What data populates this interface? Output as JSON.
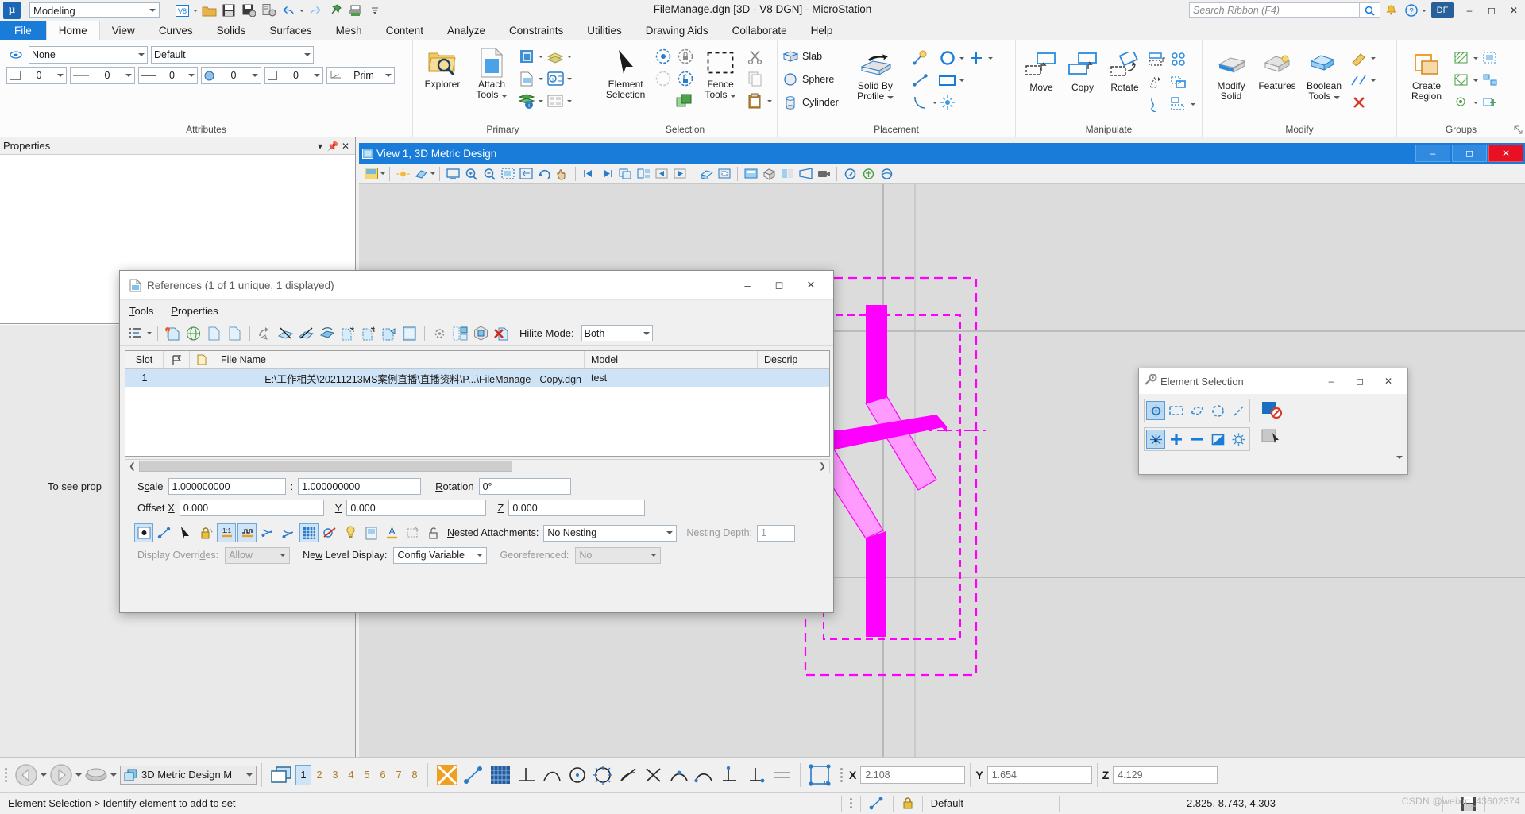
{
  "titlebar": {
    "app_title": "FileManage.dgn [3D - V8 DGN] - MicroStation",
    "workspace": "Modeling",
    "search_placeholder": "Search Ribbon (F4)",
    "user_initials": "DF",
    "logo_text": "μ",
    "quick_access": [
      {
        "name": "v8-format-icon",
        "label": "V8"
      },
      {
        "name": "open-file-icon",
        "label": "Open"
      },
      {
        "name": "save-icon",
        "label": "Save"
      },
      {
        "name": "save-settings-icon",
        "label": "Save Settings"
      },
      {
        "name": "save-as-icon",
        "label": "Save As"
      },
      {
        "name": "undo-icon",
        "label": "Undo"
      },
      {
        "name": "redo-icon",
        "label": "Redo"
      },
      {
        "name": "pin-icon",
        "label": "Pin"
      },
      {
        "name": "print-icon",
        "label": "Print"
      },
      {
        "name": "customize-icon",
        "label": "Customize Quick Access Toolbar"
      }
    ],
    "window_buttons": [
      "minimize",
      "maximize",
      "close"
    ]
  },
  "ribbon": {
    "tabs": [
      {
        "label": "File",
        "state": "file"
      },
      {
        "label": "Home",
        "state": "active"
      },
      {
        "label": "View",
        "state": "normal"
      },
      {
        "label": "Curves",
        "state": "normal"
      },
      {
        "label": "Solids",
        "state": "normal"
      },
      {
        "label": "Surfaces",
        "state": "normal"
      },
      {
        "label": "Mesh",
        "state": "normal"
      },
      {
        "label": "Content",
        "state": "normal"
      },
      {
        "label": "Analyze",
        "state": "normal"
      },
      {
        "label": "Constraints",
        "state": "normal"
      },
      {
        "label": "Utilities",
        "state": "normal"
      },
      {
        "label": "Drawing Aids",
        "state": "normal"
      },
      {
        "label": "Collaborate",
        "state": "normal"
      },
      {
        "label": "Help",
        "state": "normal"
      }
    ],
    "groups": [
      {
        "name": "attributes",
        "label": "Attributes",
        "level_value": "None",
        "style_value": "Default",
        "color_value": "0",
        "weight_value": "0",
        "linestyle_value": "0",
        "transparency_value": "0",
        "priority_value": "0",
        "prim_label": "Prim"
      },
      {
        "name": "primary",
        "label": "Primary",
        "buttons": [
          "Explorer",
          "Attach Tools"
        ]
      },
      {
        "name": "selection",
        "label": "Selection",
        "buttons": [
          "Element Selection",
          "Fence Tools"
        ]
      },
      {
        "name": "placement",
        "label": "Placement",
        "buttons": [
          "Slab",
          "Sphere",
          "Cylinder",
          "Solid By Profile"
        ]
      },
      {
        "name": "manipulate",
        "label": "Manipulate",
        "buttons": [
          "Move",
          "Copy",
          "Rotate"
        ]
      },
      {
        "name": "modify",
        "label": "Modify",
        "buttons": [
          "Modify Solid",
          "Features",
          "Boolean Tools"
        ]
      },
      {
        "name": "groups",
        "label": "Groups",
        "buttons": [
          "Create Region"
        ]
      }
    ]
  },
  "properties_panel": {
    "title": "Properties",
    "message": "To see prop",
    "header_buttons": [
      "dropdown",
      "pin",
      "close"
    ]
  },
  "view_window": {
    "title": "View 1, 3D Metric Design",
    "window_buttons": [
      "minimize",
      "restore",
      "close"
    ],
    "toolbar_icons": [
      "view-attributes-icon",
      "adjust-brightness-icon",
      "display-style-icon",
      "update-view-icon",
      "zoom-in-icon",
      "zoom-out-icon",
      "window-area-icon",
      "fit-view-icon",
      "rotate-view-icon",
      "pan-view-icon",
      "view-previous-icon",
      "view-next-icon",
      "copy-view-icon",
      "change-view-perspective-icon",
      "clip-volume-icon",
      "clip-mask-icon",
      "render-icon",
      "camera-icon",
      "navigate-icon",
      "walk-icon",
      "fly-icon"
    ]
  },
  "references_dialog": {
    "title": "References (1 of 1 unique, 1 displayed)",
    "menus": [
      "Tools",
      "Properties"
    ],
    "hilite_label": "Hilite Mode:",
    "hilite_value": "Both",
    "columns": [
      "Slot",
      "flag-column",
      "file-column",
      "File Name",
      "Model",
      "Descrip"
    ],
    "column_headers": {
      "slot": "Slot",
      "file_name": "File Name",
      "model": "Model",
      "description": "Descrip"
    },
    "rows": [
      {
        "slot": "1",
        "file_name": "E:\\工作相关\\20211213MS案例直播\\直播资料\\P...\\FileManage - Copy.dgn",
        "model": "test",
        "description": ""
      }
    ],
    "fields": {
      "scale_label": "Scale",
      "scale_master": "1.000000000",
      "scale_sep": ":",
      "scale_ref": "1.000000000",
      "rotation_label": "Rotation",
      "rotation_value": "0°",
      "offset_label": "Offset X",
      "offset_x": "0.000",
      "offset_y_label": "Y",
      "offset_y": "0.000",
      "offset_z_label": "Z",
      "offset_z": "0.000"
    },
    "options": {
      "nested_label": "Nested Attachments:",
      "nested_value": "No Nesting",
      "nesting_depth_label": "Nesting Depth:",
      "nesting_depth_value": "1",
      "display_overrides_label": "Display Overrides:",
      "display_overrides_value": "Allow",
      "new_level_display_label": "New Level Display:",
      "new_level_display_value": "Config Variable",
      "georeferenced_label": "Georeferenced:",
      "georeferenced_value": "No"
    },
    "window_buttons": [
      "minimize",
      "maximize",
      "close"
    ]
  },
  "element_selection": {
    "title": "Element Selection",
    "window_buttons": [
      "minimize",
      "maximize",
      "close"
    ],
    "method_icons": [
      "individual-icon",
      "block-icon",
      "shape-icon",
      "circle-icon",
      "line-icon"
    ],
    "mode_icons": [
      "new-icon",
      "add-icon",
      "subtract-icon",
      "invert-icon",
      "clear-icon"
    ],
    "right_icons": [
      "no-selection-icon",
      "pointer-icon"
    ]
  },
  "bottom_bar": {
    "model_name": "3D Metric Design M",
    "view_numbers": [
      "1",
      "2",
      "3",
      "4",
      "5",
      "6",
      "7",
      "8"
    ],
    "active_view": "1",
    "coords": {
      "x_label": "X",
      "x_value": "2.108",
      "y_label": "Y",
      "y_value": "1.654",
      "z_label": "Z",
      "z_value": "4.129"
    },
    "tool_icons": [
      "back-icon",
      "forward-icon",
      "models-icon",
      "view-groups-icon",
      "snap-multi-icon",
      "acs-icon",
      "perp-icon",
      "tangent-icon",
      "circle-snap-icon",
      "center-snap-icon",
      "origin-snap-icon",
      "bisector-snap-icon",
      "intersection-snap-icon",
      "nearest-snap-icon",
      "midpoint-snap-icon",
      "keypoint-snap-icon",
      "point-snap-icon",
      "parallel-snap-icon",
      "snap-settings-icon"
    ]
  },
  "status_bar": {
    "message": "Element Selection > Identify element to add to set",
    "snap_icon": "keypoint-snap-icon",
    "lock_icon": "locks-icon",
    "level": "Default",
    "coordinates": "2.825, 8.743, 4.303",
    "save_icon": "save-icon",
    "watermark": "CSDN @weixin_43602374"
  },
  "colors": {
    "accent": "#1a7cd9",
    "ribbon_bg": "#fcfcfc",
    "chrome_bg": "#f0f0f0",
    "magenta": "#ff00ff",
    "light_magenta": "#ff9bff",
    "canvas": "#dcdcdc",
    "selection_blue": "#cfe3f7"
  }
}
